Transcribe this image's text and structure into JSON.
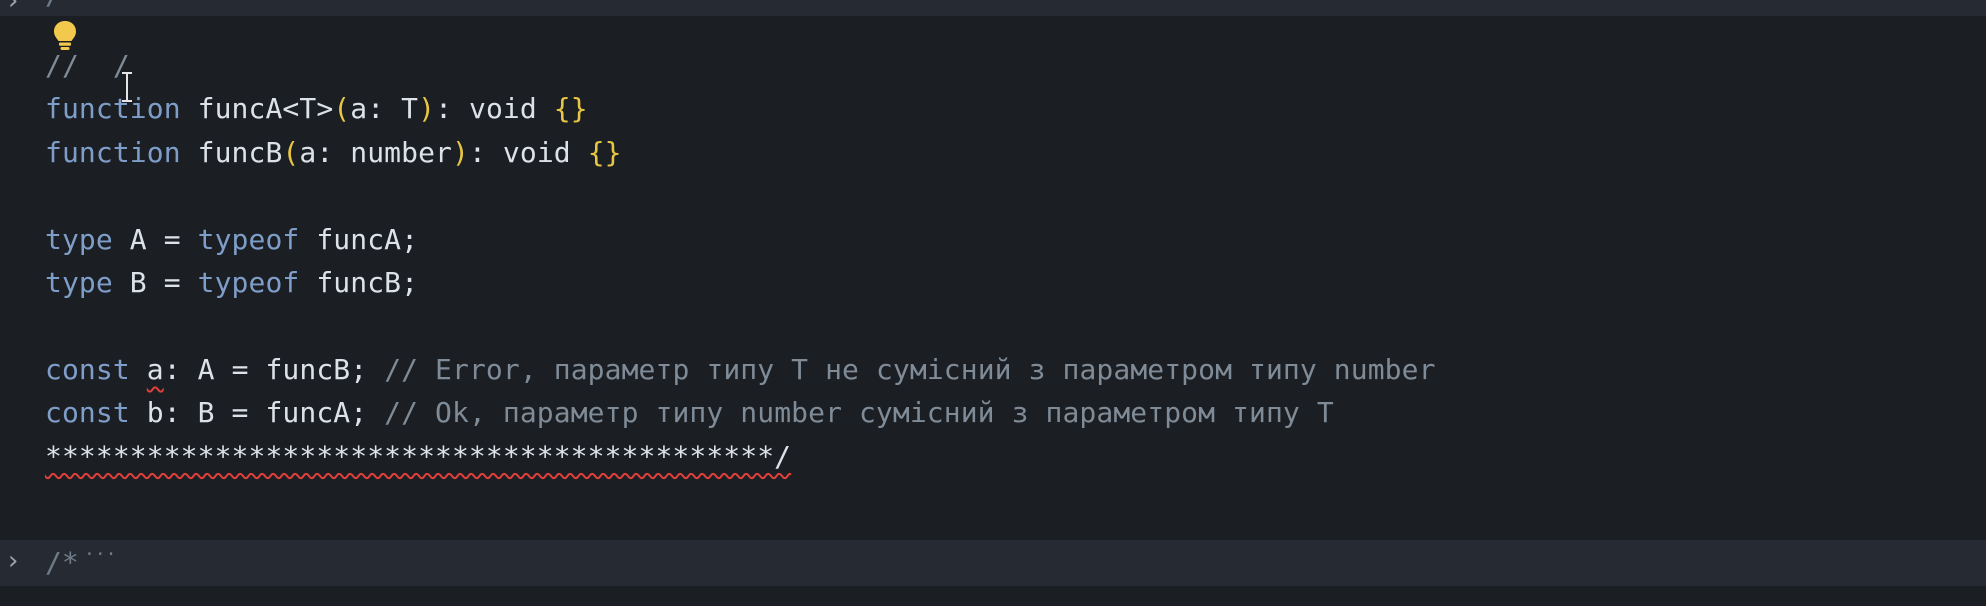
{
  "editor": {
    "folded_top_text": "/*",
    "folded_bottom_text": "/*",
    "folded_ellipsis": "···",
    "colors": {
      "background": "#1b1e23",
      "fold_band": "#262b33",
      "keyword": "#7e9ec9",
      "comment": "#7f8b97",
      "text": "#dde2e8",
      "brace": "#e8c545",
      "error_squiggle": "#e0403a",
      "lightbulb": "#f2c94c"
    },
    "icons": {
      "fold_chevron": "chevron-right-icon",
      "quick_fix": "lightbulb-icon",
      "cursor": "text-cursor-icon"
    },
    "lines": [
      {
        "tokens": [
          {
            "t": "//  /",
            "c": "cm"
          }
        ]
      },
      {
        "tokens": [
          {
            "t": "function",
            "c": "kw"
          },
          {
            "t": " funcA<T>",
            "c": "tk"
          },
          {
            "t": "(",
            "c": "br"
          },
          {
            "t": "a: T",
            "c": "tk"
          },
          {
            "t": ")",
            "c": "br"
          },
          {
            "t": ": void ",
            "c": "tk"
          },
          {
            "t": "{}",
            "c": "br"
          }
        ]
      },
      {
        "tokens": [
          {
            "t": "function",
            "c": "kw"
          },
          {
            "t": " funcB",
            "c": "tk"
          },
          {
            "t": "(",
            "c": "br"
          },
          {
            "t": "a: number",
            "c": "tk"
          },
          {
            "t": ")",
            "c": "br"
          },
          {
            "t": ": void ",
            "c": "tk"
          },
          {
            "t": "{}",
            "c": "br"
          }
        ]
      },
      {
        "tokens": []
      },
      {
        "tokens": [
          {
            "t": "type",
            "c": "kw"
          },
          {
            "t": " A = ",
            "c": "tk"
          },
          {
            "t": "typeof",
            "c": "kw"
          },
          {
            "t": " funcA;",
            "c": "tk"
          }
        ]
      },
      {
        "tokens": [
          {
            "t": "type",
            "c": "kw"
          },
          {
            "t": " B = ",
            "c": "tk"
          },
          {
            "t": "typeof",
            "c": "kw"
          },
          {
            "t": " funcB;",
            "c": "tk"
          }
        ]
      },
      {
        "tokens": []
      },
      {
        "tokens": [
          {
            "t": "const",
            "c": "kw"
          },
          {
            "t": " ",
            "c": "tk"
          },
          {
            "t": "a",
            "c": "tk",
            "err": true
          },
          {
            "t": ": A = funcB; ",
            "c": "tk"
          },
          {
            "t": "// Error, параметр типу T не сумісний з параметром типу number",
            "c": "cm"
          }
        ]
      },
      {
        "tokens": [
          {
            "t": "const",
            "c": "kw"
          },
          {
            "t": " b: B = funcA; ",
            "c": "tk"
          },
          {
            "t": "// Ok, параметр типу number сумісний з параметром типу T",
            "c": "cm"
          }
        ]
      },
      {
        "tokens": [
          {
            "t": "*******************************************/",
            "c": "tk",
            "err": true
          }
        ]
      }
    ]
  }
}
